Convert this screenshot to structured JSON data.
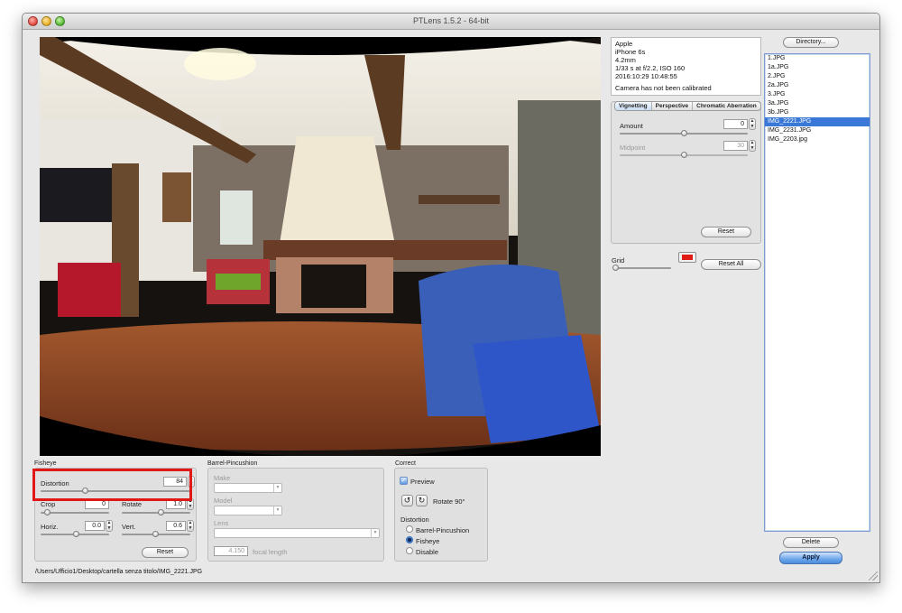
{
  "window": {
    "title": "PTLens 1.5.2 - 64-bit"
  },
  "exif": {
    "lines": [
      "Apple",
      "iPhone 6s",
      "4.2mm",
      "1/33 s at f/2.2, ISO 160",
      "2016:10:29 10:48:55"
    ],
    "status": "Camera has not been calibrated"
  },
  "tabs": [
    "Vignetting",
    "Perspective",
    "Chromatic Aberration"
  ],
  "vignetting": {
    "amount_label": "Amount",
    "amount_value": "0",
    "midpoint_label": "Midpoint",
    "midpoint_value": "30",
    "reset_label": "Reset"
  },
  "grid": {
    "label": "Grid",
    "color": "#e01b16",
    "reset_all_label": "Reset All"
  },
  "files": {
    "directory_label": "Directory...",
    "items": [
      "1.JPG",
      "1a.JPG",
      "2.JPG",
      "2a.JPG",
      "3.JPG",
      "3a.JPG",
      "3b.JPG",
      "IMG_2221.JPG",
      "IMG_2231.JPG",
      "IMG_2203.jpg"
    ],
    "selected_index": 7,
    "delete_label": "Delete",
    "apply_label": "Apply"
  },
  "fisheye": {
    "title": "Fisheye",
    "distortion_label": "Distortion",
    "distortion_value": "84",
    "crop_label": "Crop",
    "crop_value": "0",
    "rotate_label": "Rotate",
    "rotate_value": "1.0",
    "horiz_label": "Horiz.",
    "horiz_value": "0.0",
    "vert_label": "Vert.",
    "vert_value": "0.6",
    "reset_label": "Reset"
  },
  "barrel": {
    "title": "Barrel-Pincushion",
    "make_label": "Make",
    "model_label": "Model",
    "lens_label": "Lens",
    "focal_value": "4.150",
    "focal_label": "focal length"
  },
  "correct": {
    "title": "Correct",
    "preview_label": "Preview",
    "rotate_label": "Rotate 90°",
    "distortion_title": "Distortion",
    "options": [
      "Barrel-Pincushion",
      "Fisheye",
      "Disable"
    ],
    "selected_option": "Fisheye"
  },
  "status_path": "/Users/Ufficio1/Desktop/cartella senza titolo/IMG_2221.JPG",
  "colors": {
    "accent": "#3a78d8",
    "highlight": "#e01818"
  }
}
